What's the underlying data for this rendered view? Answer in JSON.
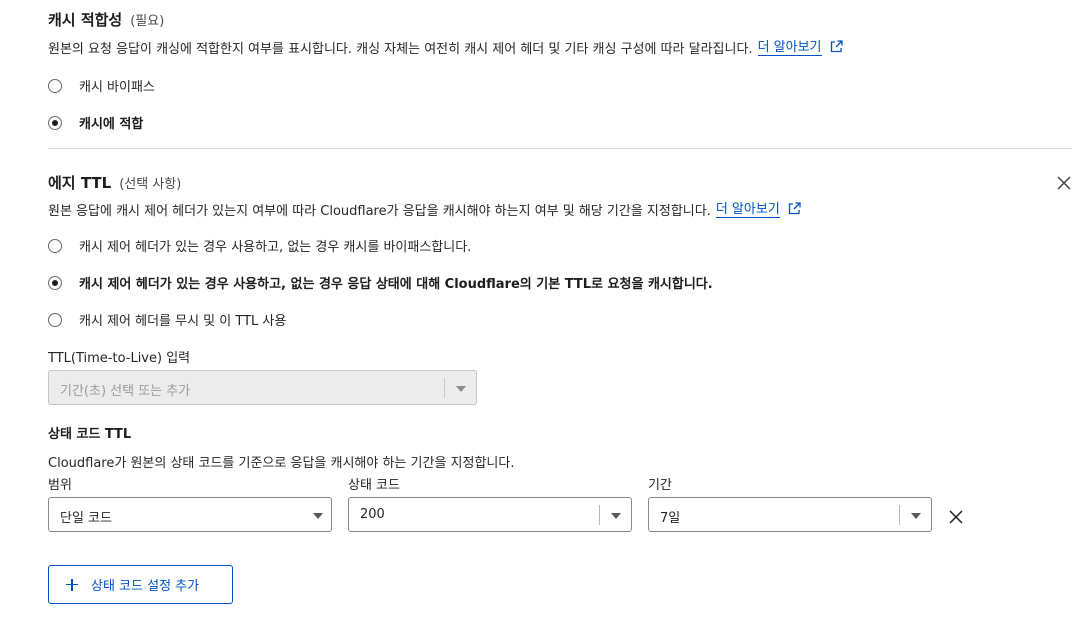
{
  "cache_eligibility": {
    "title": "캐시 적합성",
    "optional_tag": "(필요)",
    "description": "원본의 요청 응답이 캐싱에 적합한지 여부를 표시합니다. 캐싱 자체는 여전히 캐시 제어 헤더 및 기타 캐싱 구성에 따라 달라집니다.",
    "learn_more": "더 알아보기",
    "options": [
      {
        "label": "캐시 바이패스",
        "selected": false
      },
      {
        "label": "캐시에 적합",
        "selected": true
      }
    ]
  },
  "edge_ttl": {
    "title": "에지 TTL",
    "optional_tag": "(선택 사항)",
    "description": "원본 응답에 캐시 제어 헤더가 있는지 여부에 따라 Cloudflare가 응답을 캐시해야 하는지 여부 및 해당 기간을 지정합니다.",
    "learn_more": "더 알아보기",
    "options": [
      {
        "label": "캐시 제어 헤더가 있는 경우 사용하고, 없는 경우 캐시를 바이패스합니다.",
        "selected": false
      },
      {
        "label": "캐시 제어 헤더가 있는 경우 사용하고, 없는 경우 응답 상태에 대해 Cloudflare의 기본 TTL로 요청을 캐시합니다.",
        "selected": true
      },
      {
        "label": "캐시 제어 헤더를 무시 및 이 TTL 사용",
        "selected": false
      }
    ],
    "ttl_input": {
      "label": "TTL(Time-to-Live) 입력",
      "placeholder": "기간(초) 선택 또는 추가"
    }
  },
  "status_code_ttl": {
    "title": "상태 코드 TTL",
    "description": "Cloudflare가 원본의 상태 코드를 기준으로 응답을 캐시해야 하는 기간을 지정합니다.",
    "range_label": "범위",
    "range_value": "단일 코드",
    "status_label": "상태 코드",
    "status_value": "200",
    "duration_label": "기간",
    "duration_value": "7일",
    "add_button": "상태 코드 설정 추가"
  },
  "colors": {
    "link": "#0051c3",
    "divider": "#d6d6d6",
    "disabled_bg": "#ececec"
  },
  "icons": [
    "external-link-icon",
    "close-icon",
    "chevron-down-icon",
    "plus-icon"
  ]
}
